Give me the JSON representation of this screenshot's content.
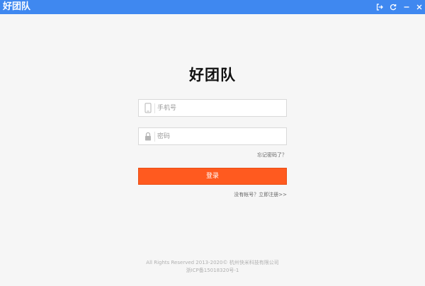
{
  "window": {
    "title": "好团队",
    "controls": [
      {
        "name": "exit-icon"
      },
      {
        "name": "refresh-icon"
      },
      {
        "name": "minimize-icon"
      },
      {
        "name": "close-icon"
      }
    ],
    "accent": "#3f88f0"
  },
  "brand": {
    "title": "好团队"
  },
  "login_form": {
    "phone_placeholder": "手机号",
    "phone_value": "",
    "password_placeholder": "密码",
    "password_value": "",
    "forgot_label": "忘记密码了？",
    "submit_label": "登录",
    "register_label": "没有帐号？立即注册>>",
    "button_color": "#ff5a1f"
  },
  "footer": {
    "copyright": "All Rights Reserved 2013-2020© 杭州快米科技有限公司",
    "icp": "浙ICP备15018320号-1"
  }
}
